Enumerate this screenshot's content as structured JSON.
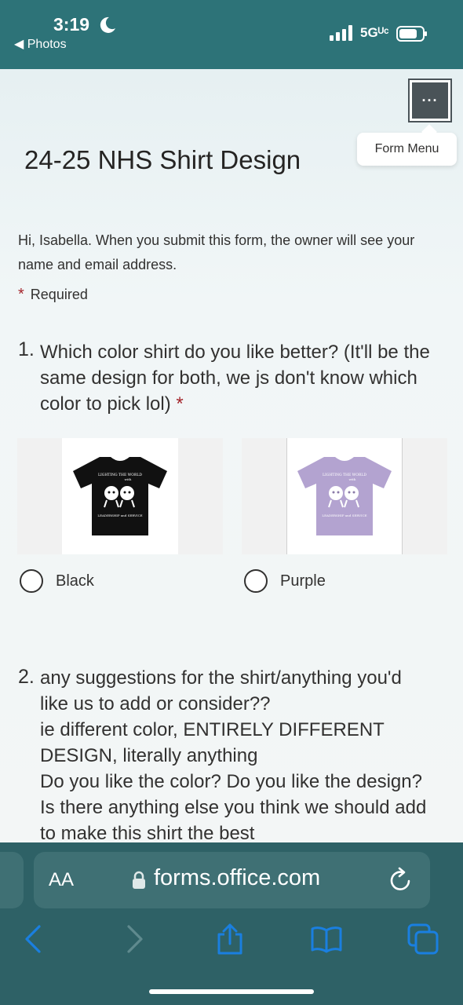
{
  "status_bar": {
    "time": "3:19",
    "back_label": "◀ Photos",
    "network": "5Gᵁᶜ",
    "moon_icon": "moon-icon",
    "signal_icon": "signal-icon",
    "battery_icon": "battery-icon"
  },
  "form": {
    "menu_button_label": "···",
    "menu_tooltip": "Form Menu",
    "title": "24-25 NHS Shirt Design",
    "notice": "Hi, Isabella. When you submit this form, the owner will see your name and email address.",
    "required_marker": "*",
    "required_label": "Required",
    "questions": [
      {
        "number": "1.",
        "text": "Which color shirt do you like better? (It'll be the same design for both, we js don't know which color to pick lol)",
        "required_star": "*",
        "options": [
          {
            "label": "Black",
            "shirt_color": "#111111",
            "shirt_text_top": "LIGHTING THE WORLD",
            "shirt_text_mid": "with",
            "shirt_text_bottom": "LEADERSHIP and SERVICE"
          },
          {
            "label": "Purple",
            "shirt_color": "#b3a3d0",
            "shirt_text_top": "LIGHTING THE WORLD",
            "shirt_text_mid": "with",
            "shirt_text_bottom": "LEADERSHIP and SERVICE"
          }
        ]
      },
      {
        "number": "2.",
        "text_lines": [
          "any suggestions for the shirt/anything you'd like us to add or consider??",
          "ie different color, ENTIRELY DIFFERENT DESIGN, literally anything",
          "Do you like the color? Do you like the design? Is there anything else you think we should add to make this shirt the best"
        ]
      }
    ]
  },
  "safari": {
    "text_size_button": "AA",
    "url": "forms.office.com",
    "lock_icon": "lock-icon",
    "reload_icon": "reload-icon",
    "toolbar_icons": [
      "back-icon",
      "forward-icon",
      "share-icon",
      "bookmarks-icon",
      "tabs-icon"
    ]
  },
  "colors": {
    "status_bar_bg": "#2d7378",
    "safari_bar_bg": "#2e6166",
    "required_red": "#a4262c",
    "menu_button_bg": "#4a5358",
    "link_blue": "#1a7fe0"
  }
}
